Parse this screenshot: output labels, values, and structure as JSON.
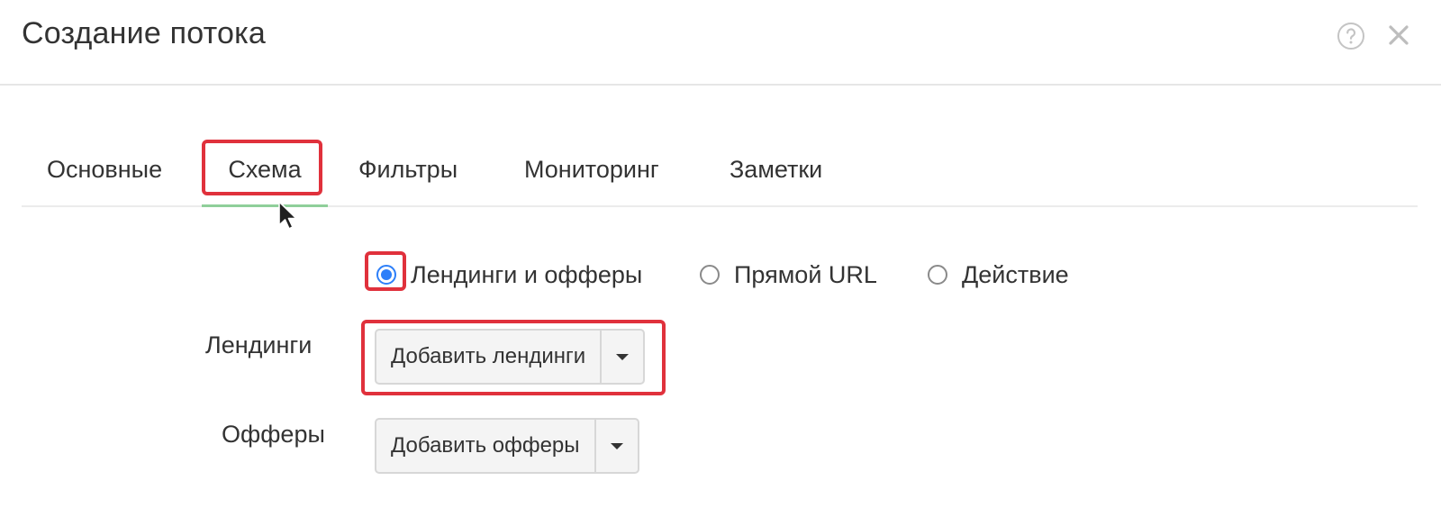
{
  "modal": {
    "title": "Создание потока"
  },
  "tabs": [
    {
      "label": "Основные"
    },
    {
      "label": "Схема"
    },
    {
      "label": "Фильтры"
    },
    {
      "label": "Мониторинг"
    },
    {
      "label": "Заметки"
    }
  ],
  "active_tab": "Схема",
  "scheme": {
    "options": [
      {
        "label": "Лендинги и офферы",
        "checked": true
      },
      {
        "label": "Прямой URL",
        "checked": false
      },
      {
        "label": "Действие",
        "checked": false
      }
    ]
  },
  "fields": {
    "landings": {
      "label": "Лендинги",
      "button_label": "Добавить лендинги"
    },
    "offers": {
      "label": "Офферы",
      "button_label": "Добавить офферы"
    }
  },
  "colors": {
    "accent_radio": "#2d7ff9",
    "active_tab_underline": "#8fcf9a",
    "annotation_red": "#e0313c"
  },
  "icons": {
    "help": "question-circle-icon",
    "close": "close-icon",
    "cursor": "mouse-pointer-icon",
    "caret": "chevron-down-icon"
  }
}
